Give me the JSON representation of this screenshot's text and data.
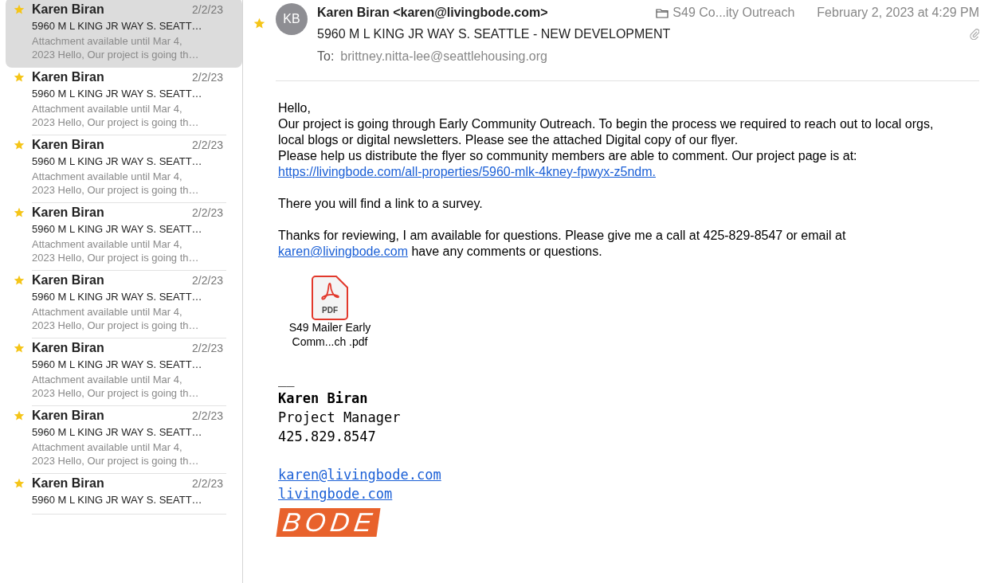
{
  "message_list": [
    {
      "sender": "Karen Biran",
      "date": "2/2/23",
      "subject": "5960 M L KING JR WAY S. SEATT…",
      "preview": "Attachment available until Mar 4, 2023 Hello, Our project is going th…",
      "starred": true,
      "selected": true
    },
    {
      "sender": "Karen Biran",
      "date": "2/2/23",
      "subject": "5960 M L KING JR WAY S. SEATT…",
      "preview": "Attachment available until Mar 4, 2023 Hello, Our project is going th…",
      "starred": true,
      "selected": false
    },
    {
      "sender": "Karen Biran",
      "date": "2/2/23",
      "subject": "5960 M L KING JR WAY S. SEATT…",
      "preview": "Attachment available until Mar 4, 2023 Hello, Our project is going th…",
      "starred": true,
      "selected": false
    },
    {
      "sender": "Karen Biran",
      "date": "2/2/23",
      "subject": "5960 M L KING JR WAY S. SEATT…",
      "preview": "Attachment available until Mar 4, 2023 Hello, Our project is going th…",
      "starred": true,
      "selected": false
    },
    {
      "sender": "Karen Biran",
      "date": "2/2/23",
      "subject": "5960 M L KING JR WAY S. SEATT…",
      "preview": "Attachment available until Mar 4, 2023 Hello, Our project is going th…",
      "starred": true,
      "selected": false
    },
    {
      "sender": "Karen Biran",
      "date": "2/2/23",
      "subject": "5960 M L KING JR WAY S. SEATT…",
      "preview": "Attachment available until Mar 4, 2023 Hello, Our project is going th…",
      "starred": true,
      "selected": false
    },
    {
      "sender": "Karen Biran",
      "date": "2/2/23",
      "subject": "5960 M L KING JR WAY S. SEATT…",
      "preview": "Attachment available until Mar 4, 2023 Hello, Our project is going th…",
      "starred": true,
      "selected": false
    },
    {
      "sender": "Karen Biran",
      "date": "2/2/23",
      "subject": "5960 M L KING JR WAY S. SEATT…",
      "starred": true,
      "selected": false
    }
  ],
  "message": {
    "starred": true,
    "avatar_initials": "KB",
    "from": "Karen Biran <karen@livingbode.com>",
    "mailbox": "S49 Co...ity Outreach",
    "date": "February 2, 2023 at 4:29 PM",
    "subject": "5960 M L KING JR WAY S. SEATTLE - NEW DEVELOPMENT",
    "to_label": "To:",
    "to": "brittney.nitta-lee@seattlehousing.org",
    "body": [
      [
        {
          "kind": "text",
          "text": "Hello,"
        },
        {
          "kind": "text",
          "text": "Our project is going through Early Community Outreach. To begin the process we required to reach out to local orgs, local blogs  or digital newsletters. Please see the attached Digital copy of our flyer."
        },
        {
          "kind": "text",
          "text": "Please help us distribute the flyer so community members are able to comment. Our project page is at:"
        },
        {
          "kind": "link",
          "text": "https://livingbode.com/all-properties/5960-mlk-4kney-fpwyx-z5ndm."
        }
      ],
      [
        {
          "kind": "text",
          "text": "There you will find a link to a survey."
        }
      ],
      [
        {
          "kind": "mixed",
          "before": "Thanks for reviewing, I am available for questions. Please give me a call at 425-829-8547 or email at",
          "link": "karen@livingbode.com",
          "after": "have any comments or questions."
        }
      ]
    ],
    "attachment": {
      "name_line1": "S49 Mailer Early",
      "name_line2": "Comm...ch .pdf",
      "badge": "PDF"
    },
    "signature": {
      "rule": "__",
      "name": "Karen Biran",
      "title": "Project Manager",
      "phone": "425.829.8547",
      "email": "karen@livingbode.com",
      "website": "livingbode.com",
      "logo": "BODE"
    }
  }
}
